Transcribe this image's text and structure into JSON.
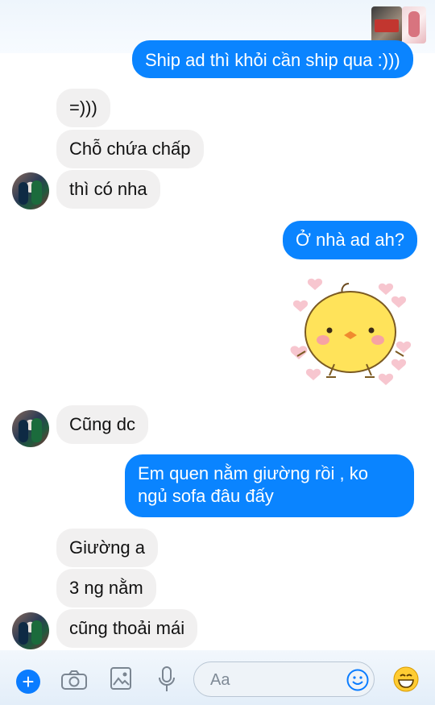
{
  "header": {
    "thumbnail_1": "image-thumbnail",
    "thumbnail_2": "image-thumbnail"
  },
  "messages": [
    {
      "side": "out",
      "text": "Ship ad thì khỏi cần ship qua :)))"
    },
    {
      "side": "in",
      "text": "=)))"
    },
    {
      "side": "in",
      "text": "Chỗ chứa chấp"
    },
    {
      "side": "in",
      "text": "thì có nha"
    },
    {
      "side": "out",
      "text": "Ở nhà ad ah?"
    },
    {
      "side": "out",
      "type": "sticker",
      "sticker": "yellow-chick-sticker"
    },
    {
      "side": "in",
      "text": "Cũng dc"
    },
    {
      "side": "out",
      "text": "Em quen nằm giường rồi , ko ngủ sofa đâu đấy"
    },
    {
      "side": "in",
      "text": "Giường a"
    },
    {
      "side": "in",
      "text": "3 ng nằm"
    },
    {
      "side": "in",
      "text": "cũng thoải mái"
    }
  ],
  "composer": {
    "placeholder": "Aa",
    "icons": [
      "plus-icon",
      "camera-icon",
      "gallery-icon",
      "microphone-icon",
      "emoji-icon",
      "emoji-reaction-icon"
    ]
  },
  "colors": {
    "outgoing_bubble": "#0a84ff",
    "incoming_bubble": "#f1f0f0",
    "accent": "#0a7cff"
  }
}
